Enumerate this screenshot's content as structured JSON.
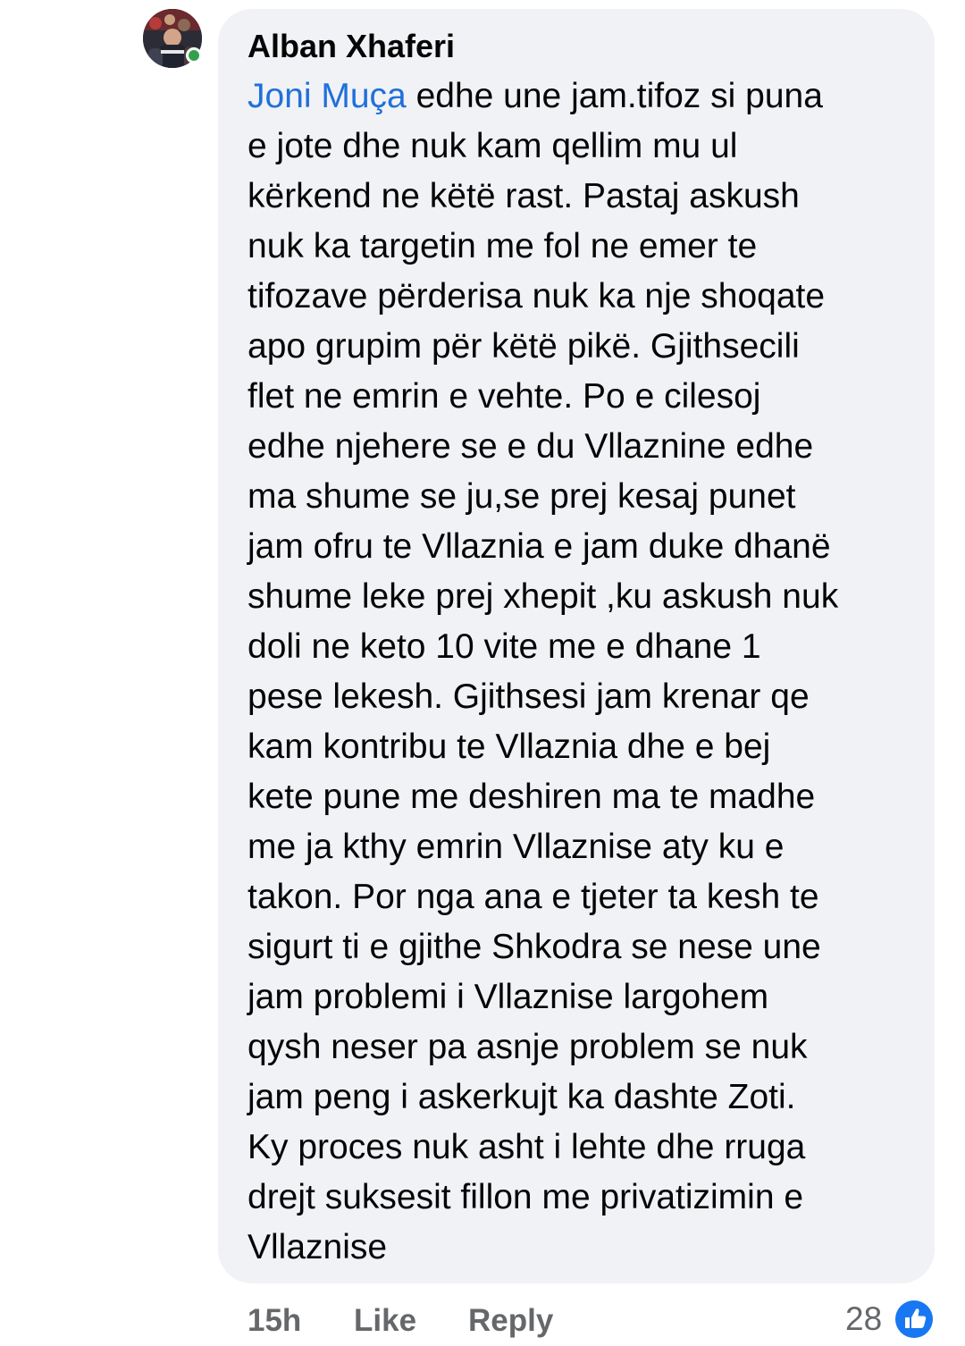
{
  "comment": {
    "author": "Alban Xhaferi",
    "mention": "Joni Muça",
    "body": " edhe une jam.tifoz si puna\ne jote dhe nuk kam qellim mu ul\nkërkend ne këtë rast. Pastaj askush\nnuk ka targetin me fol ne emer te\ntifozave përderisa nuk ka nje shoqate\napo grupim për këtë pikë. Gjithsecili\nflet ne emrin e vehte. Po e cilesoj\nedhe njehere se e du Vllaznine edhe\nma shume se ju,se prej kesaj punet\njam ofru te Vllaznia e jam duke dhanë\nshume leke prej xhepit ,ku askush nuk\ndoli ne keto 10 vite me e dhane 1\npese lekesh. Gjithsesi jam krenar qe\nkam kontribu te Vllaznia dhe e  bej\nkete pune me deshiren ma te madhe\nme ja kthy emrin Vllaznise aty ku e\ntakon. Por nga ana e tjeter ta kesh te\nsigurt ti e gjithe Shkodra se nese une\njam problemi i Vllaznise largohem\nqysh neser pa asnje problem se nuk\njam peng i askerkujt ka dashte Zoti.\nKy proces nuk asht i lehte dhe rruga\ndrejt suksesit fillon me privatizimin e\nVllaznise",
    "timestamp": "15h",
    "like_label": "Like",
    "reply_label": "Reply",
    "reaction_count": "28"
  },
  "colors": {
    "bubble": "#f0f2f5",
    "mention": "#216fdb",
    "secondary_text": "#65676b",
    "online": "#31a24c",
    "like_reaction": "#1877f2"
  },
  "icons": {
    "avatar": "profile-photo",
    "status": "online-dot",
    "reaction": "thumbs-up-icon"
  }
}
